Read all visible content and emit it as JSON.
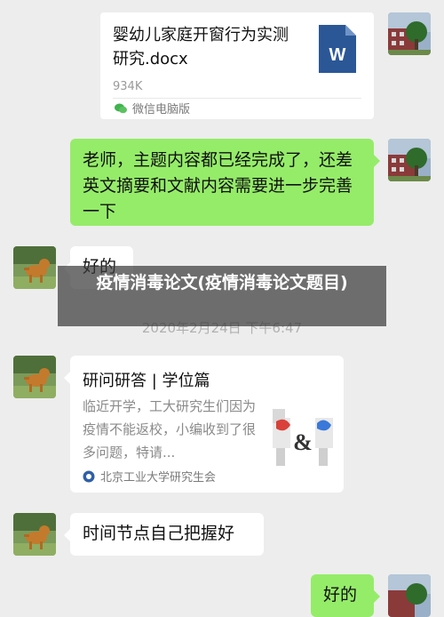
{
  "file_message": {
    "title": "婴幼儿家庭开窗行为实测研究.docx",
    "size": "934K",
    "doc_icon_letter": "W",
    "source": "微信电脑版"
  },
  "messages": {
    "teacher_done": "老师，主题内容都已经完成了，还差英文摘要和文献内容需要进一步完善一下",
    "reply_good": "好的",
    "time_node": "时间节点自己把握好",
    "reply_good_bottom": "好的"
  },
  "link_card": {
    "title": "研问研答 | 学位篇",
    "description": "临近开学，工大研究生们因为疫情不能返校，小编收到了很多问题，特请...",
    "source": "北京工业大学研究生会"
  },
  "timestamp": "2020年2月24日 下午6:47",
  "overlay_title": "疫情消毒论文(疫情消毒论文题目)",
  "colors": {
    "background": "#ededed",
    "sent_bubble": "#95ec69",
    "received_bubble": "#ffffff",
    "word_blue": "#2b5797"
  },
  "icons": {
    "doc": "word-doc-icon",
    "wechat": "wechat-icon",
    "university": "university-logo-icon"
  }
}
